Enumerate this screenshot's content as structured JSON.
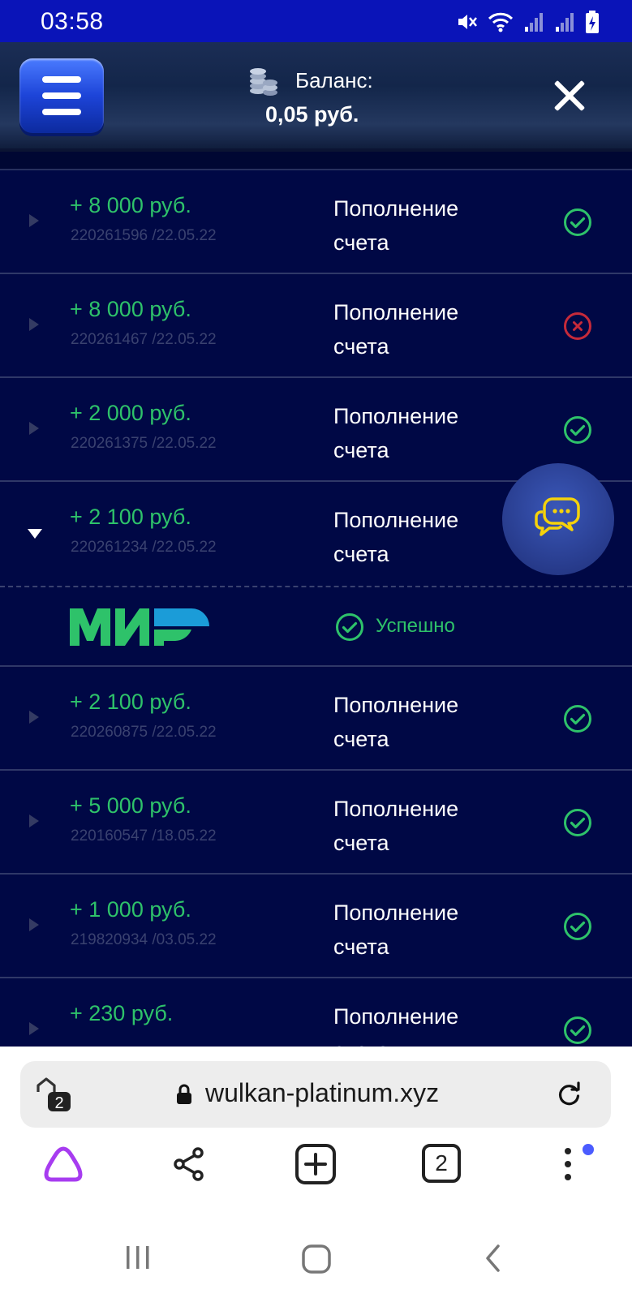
{
  "status_bar": {
    "time": "03:58"
  },
  "header": {
    "balance_label": "Баланс:",
    "balance_value": "0,05 руб."
  },
  "transactions": [
    {
      "amount": "+ 8 000 руб.",
      "meta": "220261596 /22.05.22",
      "type": "Пополнение счета",
      "status": "success"
    },
    {
      "amount": "+ 8 000 руб.",
      "meta": "220261467 /22.05.22",
      "type": "Пополнение счета",
      "status": "failed"
    },
    {
      "amount": "+ 2 000 руб.",
      "meta": "220261375 /22.05.22",
      "type": "Пополнение счета",
      "status": "success"
    },
    {
      "amount": "+ 2 100 руб.",
      "meta": "220261234 /22.05.22",
      "type": "Пополнение счета",
      "status": "expanded"
    },
    {
      "amount": "+ 2 100 руб.",
      "meta": "220260875 /22.05.22",
      "type": "Пополнение счета",
      "status": "success"
    },
    {
      "amount": "+ 5 000 руб.",
      "meta": "220160547 /18.05.22",
      "type": "Пополнение счета",
      "status": "success"
    },
    {
      "amount": "+ 1 000 руб.",
      "meta": "219820934 /03.05.22",
      "type": "Пополнение счета",
      "status": "success"
    },
    {
      "amount": "+ 230 руб.",
      "meta": "",
      "type": "Пополнение счета",
      "status": "success"
    }
  ],
  "expanded_detail": {
    "payment_method": "МИР",
    "status_label": "Успешно"
  },
  "browser": {
    "tab_count_badge": "2",
    "url": "wulkan-platinum.xyz",
    "tab_count": "2"
  },
  "colors": {
    "success": "#2ec26a",
    "failed": "#c62a3a",
    "background": "#000845",
    "status_bar": "#0a14b8"
  }
}
